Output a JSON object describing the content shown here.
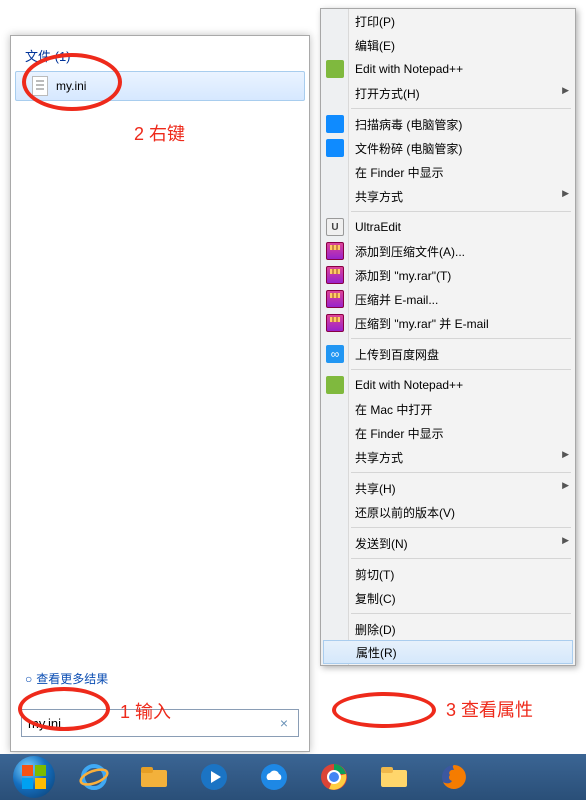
{
  "search": {
    "header": "文件 (1)",
    "filename": "my.ini",
    "more_results": "查看更多结果",
    "input_value": "my.ini",
    "clear_label": "×"
  },
  "menu": {
    "items": [
      {
        "label": "打印(P)",
        "icon": null,
        "sub": false,
        "sep": false
      },
      {
        "label": "编辑(E)",
        "icon": null,
        "sub": false,
        "sep": false
      },
      {
        "label": "Edit with Notepad++",
        "icon": "np",
        "sub": false,
        "sep": false
      },
      {
        "label": "打开方式(H)",
        "icon": null,
        "sub": true,
        "sep": false
      },
      {
        "sep": true
      },
      {
        "label": "扫描病毒 (电脑管家)",
        "icon": "shield",
        "sub": false,
        "sep": false
      },
      {
        "label": "文件粉碎 (电脑管家)",
        "icon": "shield",
        "sub": false,
        "sep": false
      },
      {
        "label": "在 Finder 中显示",
        "icon": null,
        "sub": false,
        "sep": false
      },
      {
        "label": "共享方式",
        "icon": null,
        "sub": true,
        "sep": false
      },
      {
        "sep": true
      },
      {
        "label": "UltraEdit",
        "icon": "ue",
        "sub": false,
        "sep": false
      },
      {
        "label": "添加到压缩文件(A)...",
        "icon": "rar",
        "sub": false,
        "sep": false
      },
      {
        "label": "添加到 \"my.rar\"(T)",
        "icon": "rar",
        "sub": false,
        "sep": false
      },
      {
        "label": "压缩并 E-mail...",
        "icon": "rar",
        "sub": false,
        "sep": false
      },
      {
        "label": "压缩到 \"my.rar\" 并 E-mail",
        "icon": "rar",
        "sub": false,
        "sep": false
      },
      {
        "sep": true
      },
      {
        "label": "上传到百度网盘",
        "icon": "bd",
        "sub": false,
        "sep": false
      },
      {
        "sep": true
      },
      {
        "label": "Edit with Notepad++",
        "icon": "np",
        "sub": false,
        "sep": false
      },
      {
        "label": "在 Mac 中打开",
        "icon": null,
        "sub": false,
        "sep": false
      },
      {
        "label": "在 Finder 中显示",
        "icon": null,
        "sub": false,
        "sep": false
      },
      {
        "label": "共享方式",
        "icon": null,
        "sub": true,
        "sep": false
      },
      {
        "sep": true
      },
      {
        "label": "共享(H)",
        "icon": null,
        "sub": true,
        "sep": false
      },
      {
        "label": "还原以前的版本(V)",
        "icon": null,
        "sub": false,
        "sep": false
      },
      {
        "sep": true
      },
      {
        "label": "发送到(N)",
        "icon": null,
        "sub": true,
        "sep": false
      },
      {
        "sep": true
      },
      {
        "label": "剪切(T)",
        "icon": null,
        "sub": false,
        "sep": false
      },
      {
        "label": "复制(C)",
        "icon": null,
        "sub": false,
        "sep": false
      },
      {
        "sep": true
      },
      {
        "label": "删除(D)",
        "icon": null,
        "sub": false,
        "sep": false
      },
      {
        "label": "属性(R)",
        "icon": null,
        "sub": false,
        "sep": false,
        "hover": true
      }
    ]
  },
  "annotations": {
    "a1": "1 输入",
    "a2": "2 右键",
    "a3": "3 查看属性"
  },
  "taskbar_icons": [
    "start",
    "ie",
    "folder1",
    "wmp",
    "cloud",
    "chrome",
    "explorer",
    "firefox"
  ]
}
